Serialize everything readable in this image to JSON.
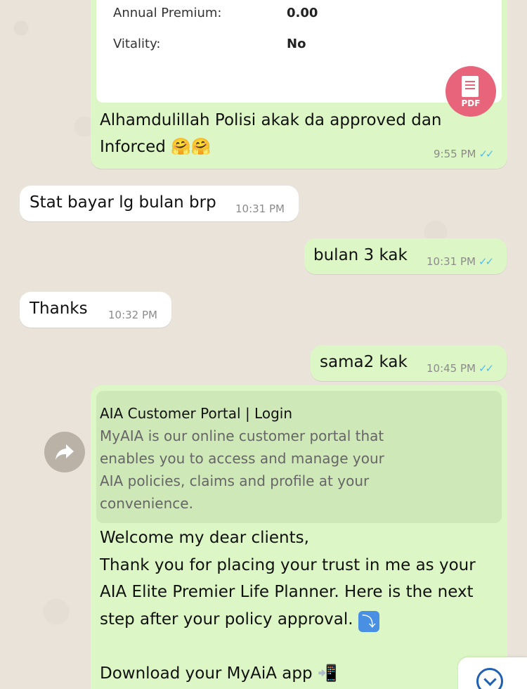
{
  "colors": {
    "incoming_bubble": "#ffffff",
    "outgoing_bubble": "#dcf7c5",
    "read_ticks": "#53bdeb",
    "pdf_badge": "#e8647a",
    "link_preview": "#cfe8b8"
  },
  "document_message": {
    "rows": [
      {
        "label": "Annual Premium:",
        "value": "0.00"
      },
      {
        "label": "Vitality:",
        "value": "No"
      }
    ],
    "badge_label": "PDF",
    "caption_line1": "Alhamdulillah Polisi akak da approved dan",
    "caption_line2": "Inforced",
    "caption_emoji": "🤗🤗",
    "time": "9:55 PM",
    "status_icon": "double-check-read-icon"
  },
  "messages": [
    {
      "text": "Stat bayar lg bulan brp",
      "time": "10:31 PM",
      "direction": "incoming"
    },
    {
      "text": "bulan 3 kak",
      "time": "10:31 PM",
      "direction": "outgoing"
    },
    {
      "text": "Thanks",
      "time": "10:32 PM",
      "direction": "incoming"
    },
    {
      "text": "sama2 kak",
      "time": "10:45 PM",
      "direction": "outgoing"
    }
  ],
  "link_message": {
    "preview_title": "AIA Customer Portal | Login",
    "preview_desc_lines": [
      "MyAIA is our online customer portal that",
      "enables you to access and manage your",
      "AIA policies, claims and profile at your",
      "convenience."
    ],
    "body_lines": [
      "Welcome my dear clients,",
      "Thank you for placing your trust in me as your",
      "AIA Elite Premier Life Planner. Here is the next",
      "step after your policy approval.",
      "",
      "Download your MyAiA app"
    ],
    "emoji_arrow": "⤵",
    "emoji_phone": "📲"
  },
  "icons": {
    "forward": "forward-icon",
    "scroll": "scroll-down-icon"
  }
}
